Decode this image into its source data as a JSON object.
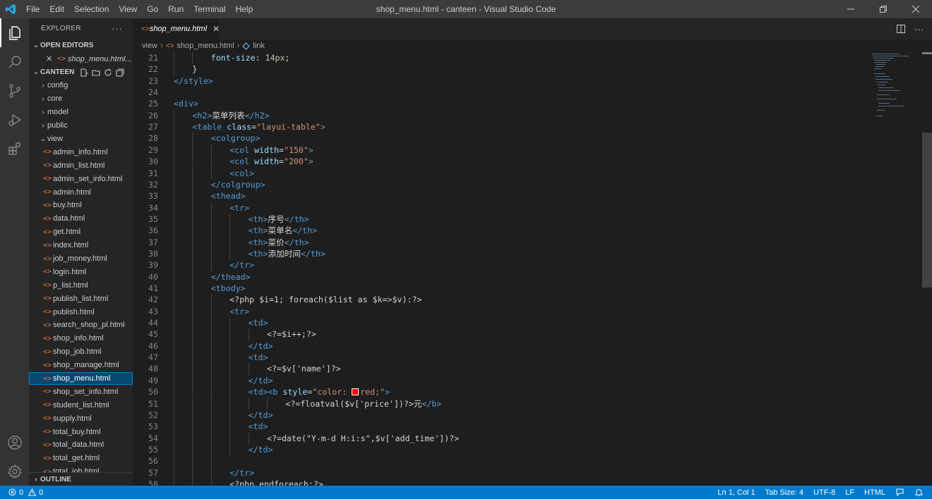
{
  "window": {
    "title": "shop_menu.html - canteen - Visual Studio Code",
    "menu": [
      "File",
      "Edit",
      "Selection",
      "View",
      "Go",
      "Run",
      "Terminal",
      "Help"
    ]
  },
  "sidebar": {
    "title": "EXPLORER",
    "open_editors_label": "OPEN EDITORS",
    "open_editor_file": "shop_menu.html...",
    "project_label": "CANTEEN",
    "folders": [
      "config",
      "core",
      "model",
      "public",
      "view"
    ],
    "files": [
      "admin_info.html",
      "admin_list.html",
      "admin_set_info.html",
      "admin.html",
      "buy.html",
      "data.html",
      "get.html",
      "index.html",
      "job_money.html",
      "login.html",
      "p_list.html",
      "publish_list.html",
      "publish.html",
      "search_shop_pl.html",
      "shop_info.html",
      "shop_job.html",
      "shop_manage.html",
      "shop_menu.html",
      "shop_set_info.html",
      "student_list.html",
      "supply.html",
      "total_buy.html",
      "total_data.html",
      "total_get.html",
      "total_job.html"
    ],
    "selected_file": "shop_menu.html",
    "outline_label": "OUTLINE"
  },
  "editor": {
    "tab_label": "shop_menu.html",
    "breadcrumb": [
      "view",
      "shop_menu.html",
      "link"
    ],
    "code_lines": [
      {
        "n": "21",
        "i": 2,
        "t": [
          [
            "font-size",
            "t-prop"
          ],
          [
            ": ",
            "t-txt"
          ],
          [
            "14px",
            "t-num"
          ],
          [
            ";",
            "t-txt"
          ]
        ]
      },
      {
        "n": "22",
        "i": 1,
        "t": [
          [
            "}",
            "t-txt"
          ]
        ]
      },
      {
        "n": "23",
        "i": 0,
        "t": [
          [
            "</style>",
            "t-tag"
          ]
        ]
      },
      {
        "n": "24",
        "i": 0,
        "t": []
      },
      {
        "n": "25",
        "i": 0,
        "t": [
          [
            "<div>",
            "t-tag"
          ]
        ]
      },
      {
        "n": "26",
        "i": 1,
        "t": [
          [
            "<h2>",
            "t-tag"
          ],
          [
            "菜单列表",
            "t-txt"
          ],
          [
            "</h2>",
            "t-tag"
          ]
        ]
      },
      {
        "n": "27",
        "i": 1,
        "t": [
          [
            "<table ",
            "t-tag"
          ],
          [
            "class",
            "t-attr"
          ],
          [
            "=",
            "t-txt"
          ],
          [
            "\"layui-table\"",
            "t-str"
          ],
          [
            ">",
            "t-tag"
          ]
        ]
      },
      {
        "n": "28",
        "i": 2,
        "t": [
          [
            "<colgroup>",
            "t-tag"
          ]
        ]
      },
      {
        "n": "29",
        "i": 3,
        "t": [
          [
            "<col ",
            "t-tag"
          ],
          [
            "width",
            "t-attr"
          ],
          [
            "=",
            "t-txt"
          ],
          [
            "\"150\"",
            "t-str"
          ],
          [
            ">",
            "t-tag"
          ]
        ]
      },
      {
        "n": "30",
        "i": 3,
        "t": [
          [
            "<col ",
            "t-tag"
          ],
          [
            "width",
            "t-attr"
          ],
          [
            "=",
            "t-txt"
          ],
          [
            "\"200\"",
            "t-str"
          ],
          [
            ">",
            "t-tag"
          ]
        ]
      },
      {
        "n": "31",
        "i": 3,
        "t": [
          [
            "<col>",
            "t-tag"
          ]
        ]
      },
      {
        "n": "32",
        "i": 2,
        "t": [
          [
            "</colgroup>",
            "t-tag"
          ]
        ]
      },
      {
        "n": "33",
        "i": 2,
        "t": [
          [
            "<thead>",
            "t-tag"
          ]
        ]
      },
      {
        "n": "34",
        "i": 3,
        "t": [
          [
            "<tr>",
            "t-tag"
          ]
        ]
      },
      {
        "n": "35",
        "i": 4,
        "t": [
          [
            "<th>",
            "t-tag"
          ],
          [
            "序号",
            "t-txt"
          ],
          [
            "</th>",
            "t-tag"
          ]
        ]
      },
      {
        "n": "36",
        "i": 4,
        "t": [
          [
            "<th>",
            "t-tag"
          ],
          [
            "菜单名",
            "t-txt"
          ],
          [
            "</th>",
            "t-tag"
          ]
        ]
      },
      {
        "n": "37",
        "i": 4,
        "t": [
          [
            "<th>",
            "t-tag"
          ],
          [
            "菜价",
            "t-txt"
          ],
          [
            "</th>",
            "t-tag"
          ]
        ]
      },
      {
        "n": "38",
        "i": 4,
        "t": [
          [
            "<th>",
            "t-tag"
          ],
          [
            "添加时间",
            "t-txt"
          ],
          [
            "</th>",
            "t-tag"
          ]
        ]
      },
      {
        "n": "39",
        "i": 3,
        "t": [
          [
            "</tr>",
            "t-tag"
          ]
        ]
      },
      {
        "n": "40",
        "i": 2,
        "t": [
          [
            "</thead>",
            "t-tag"
          ]
        ]
      },
      {
        "n": "41",
        "i": 2,
        "t": [
          [
            "<tbody>",
            "t-tag"
          ]
        ]
      },
      {
        "n": "42",
        "i": 3,
        "t": [
          [
            "<?php $i=1; foreach($list as $k=>$v):?>",
            "t-txt"
          ]
        ]
      },
      {
        "n": "43",
        "i": 3,
        "t": [
          [
            "<tr>",
            "t-tag"
          ]
        ]
      },
      {
        "n": "44",
        "i": 4,
        "t": [
          [
            "<td>",
            "t-tag"
          ]
        ]
      },
      {
        "n": "45",
        "i": 5,
        "t": [
          [
            "<?=$i++;?>",
            "t-txt"
          ]
        ]
      },
      {
        "n": "46",
        "i": 4,
        "t": [
          [
            "</td>",
            "t-tag"
          ]
        ]
      },
      {
        "n": "47",
        "i": 4,
        "t": [
          [
            "<td>",
            "t-tag"
          ]
        ]
      },
      {
        "n": "48",
        "i": 5,
        "t": [
          [
            "<?=$v['name']?>",
            "t-txt"
          ]
        ]
      },
      {
        "n": "49",
        "i": 4,
        "t": [
          [
            "</td>",
            "t-tag"
          ]
        ]
      },
      {
        "n": "50",
        "i": 4,
        "t": [
          [
            "<td><b ",
            "t-tag"
          ],
          [
            "style",
            "t-attr"
          ],
          [
            "=",
            "t-txt"
          ],
          [
            "\"color: ",
            "t-str"
          ],
          [
            "SWATCH",
            "swatch"
          ],
          [
            "red;\"",
            "t-str"
          ],
          [
            ">",
            "t-tag"
          ]
        ]
      },
      {
        "n": "51",
        "i": 6,
        "t": [
          [
            "<?=floatval($v['price'])?>元",
            "t-txt"
          ],
          [
            "</b>",
            "t-tag"
          ]
        ]
      },
      {
        "n": "52",
        "i": 4,
        "t": [
          [
            "</td>",
            "t-tag"
          ]
        ]
      },
      {
        "n": "53",
        "i": 4,
        "t": [
          [
            "<td>",
            "t-tag"
          ]
        ]
      },
      {
        "n": "54",
        "i": 5,
        "t": [
          [
            "<?=date(\"Y-m-d H:i:s\",$v['add_time'])?>",
            "t-txt"
          ]
        ]
      },
      {
        "n": "55",
        "i": 4,
        "t": [
          [
            "</td>",
            "t-tag"
          ]
        ]
      },
      {
        "n": "56",
        "i": 3,
        "t": []
      },
      {
        "n": "57",
        "i": 3,
        "t": [
          [
            "</tr>",
            "t-tag"
          ]
        ]
      },
      {
        "n": "58",
        "i": 3,
        "t": [
          [
            "<?php endforeach;?>",
            "t-txt"
          ]
        ]
      }
    ]
  },
  "statusbar": {
    "errors": "0",
    "warnings": "0",
    "position": "Ln 1, Col 1",
    "tab_size": "Tab Size: 4",
    "encoding": "UTF-8",
    "eol": "LF",
    "language": "HTML"
  },
  "colors": {
    "accent": "#007acc",
    "selection": "#094771",
    "file_icon": "#e37933"
  }
}
